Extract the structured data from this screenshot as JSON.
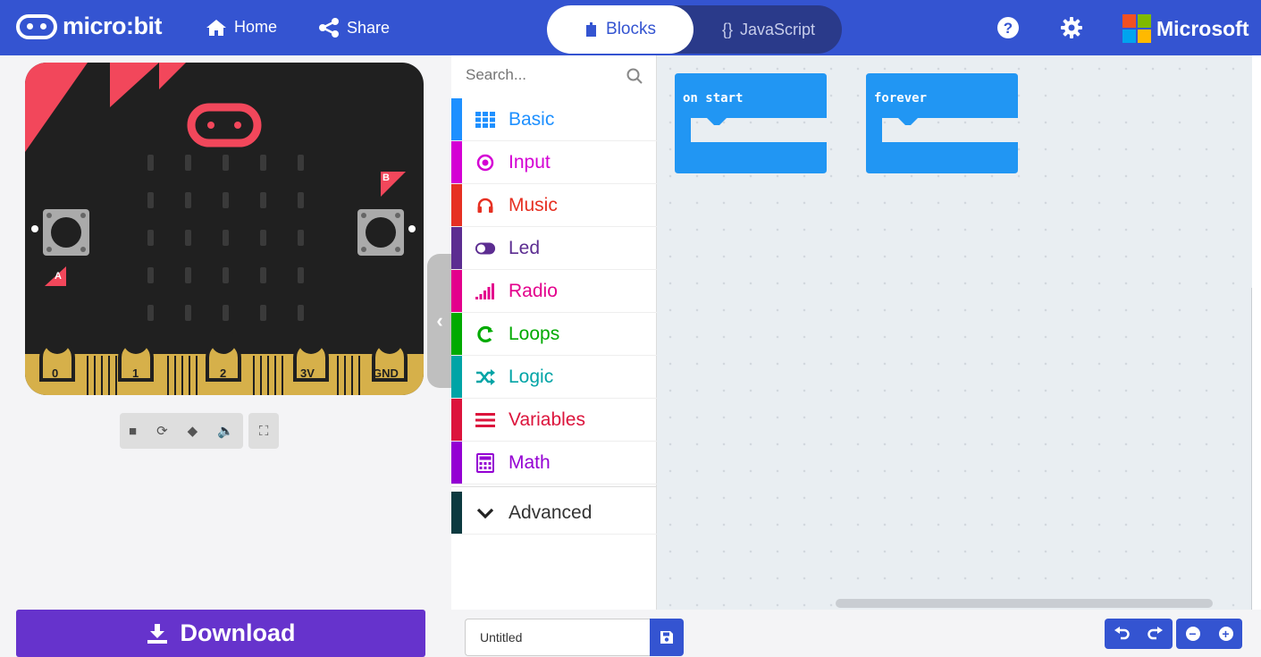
{
  "header": {
    "logo_text": "micro:bit",
    "home_label": "Home",
    "share_label": "Share",
    "blocks_label": "Blocks",
    "javascript_label": "JavaScript",
    "brand_label": "Microsoft"
  },
  "simulator": {
    "button_a_label": "A",
    "button_b_label": "B",
    "pins": [
      "0",
      "1",
      "2",
      "3V",
      "GND"
    ]
  },
  "toolbox": {
    "search_placeholder": "Search...",
    "categories": [
      {
        "label": "Basic",
        "color": "#1e90ff",
        "icon": "grid-icon"
      },
      {
        "label": "Input",
        "color": "#d400d4",
        "icon": "target-icon"
      },
      {
        "label": "Music",
        "color": "#e63022",
        "icon": "headphones-icon"
      },
      {
        "label": "Led",
        "color": "#5c2d91",
        "icon": "toggle-icon"
      },
      {
        "label": "Radio",
        "color": "#e3008c",
        "icon": "signal-bars-icon"
      },
      {
        "label": "Loops",
        "color": "#00aa00",
        "icon": "refresh-icon"
      },
      {
        "label": "Logic",
        "color": "#00a4a6",
        "icon": "shuffle-icon"
      },
      {
        "label": "Variables",
        "color": "#dc143c",
        "icon": "list-lines-icon"
      },
      {
        "label": "Math",
        "color": "#9400d3",
        "icon": "calculator-icon"
      }
    ],
    "advanced_label": "Advanced",
    "advanced_color": "#0c3a40"
  },
  "workspace": {
    "blocks": [
      {
        "label": "on start",
        "color": "#2196f3"
      },
      {
        "label": "forever",
        "color": "#2196f3"
      }
    ]
  },
  "bottom": {
    "download_label": "Download",
    "project_name": "Untitled"
  },
  "colors": {
    "header": "#3454d1",
    "download": "#6633cc",
    "board": "#202020",
    "board_accent": "#f2475b",
    "edge_gold": "#d6b04a"
  }
}
